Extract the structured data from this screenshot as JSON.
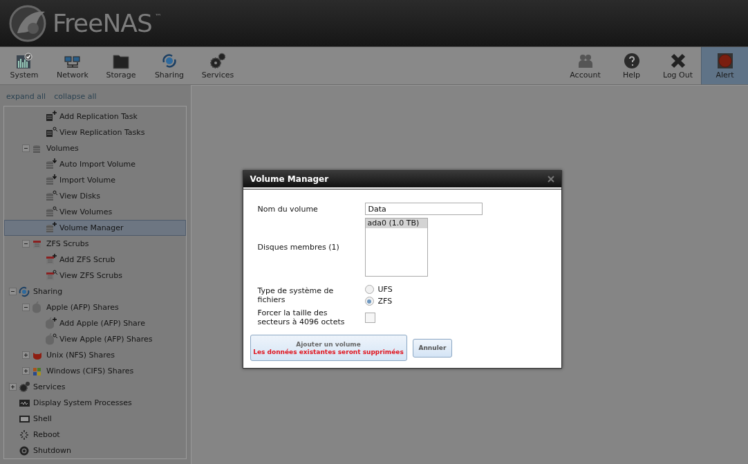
{
  "header": {
    "logo_text": "FreeNAS",
    "trademark": "™"
  },
  "toolbar": {
    "left": [
      {
        "label": "System",
        "kind": "system",
        "selected": false
      },
      {
        "label": "Network",
        "kind": "network",
        "selected": false
      },
      {
        "label": "Storage",
        "kind": "storage",
        "selected": false
      },
      {
        "label": "Sharing",
        "kind": "sharing",
        "selected": false
      },
      {
        "label": "Services",
        "kind": "services",
        "selected": false
      }
    ],
    "right": [
      {
        "label": "Account",
        "kind": "account",
        "selected": false
      },
      {
        "label": "Help",
        "kind": "help",
        "selected": false
      },
      {
        "label": "Log Out",
        "kind": "logout",
        "selected": false
      },
      {
        "label": "Alert",
        "kind": "alert",
        "selected": true
      }
    ]
  },
  "sidebar": {
    "links": [
      "expand all",
      "collapse all"
    ],
    "tree": [
      {
        "children": [
          {
            "children": [
              {
                "label": "Add Replication Task",
                "kind": "document_add",
                "selected": false
              },
              {
                "label": "View Replication Tasks",
                "kind": "document_view",
                "selected": false
              }
            ]
          },
          {
            "label": "Volumes",
            "kind": "disk",
            "expanded": true,
            "selected": false,
            "children": [
              {
                "label": "Auto Import Volume",
                "kind": "disk_import",
                "selected": false
              },
              {
                "label": "Import Volume",
                "kind": "disk_import",
                "selected": false
              },
              {
                "label": "View Disks",
                "kind": "disk_view",
                "selected": false
              },
              {
                "label": "View Volumes",
                "kind": "disk_view",
                "selected": false
              },
              {
                "label": "Volume Manager",
                "kind": "disk_add",
                "selected": true
              }
            ]
          },
          {
            "label": "ZFS Scrubs",
            "kind": "calendar",
            "expanded": true,
            "selected": false,
            "children": [
              {
                "label": "Add ZFS Scrub",
                "kind": "calendar_add",
                "selected": false
              },
              {
                "label": "View ZFS Scrubs",
                "kind": "calendar_view",
                "selected": false
              }
            ]
          }
        ]
      },
      {
        "label": "Sharing",
        "kind": "sharing",
        "expanded": true,
        "selected": false,
        "children": [
          {
            "label": "Apple (AFP) Shares",
            "kind": "apple",
            "expanded": true,
            "selected": false,
            "children": [
              {
                "label": "Add Apple (AFP) Share",
                "kind": "apple_add",
                "selected": false
              },
              {
                "label": "View Apple (AFP) Shares",
                "kind": "apple_view",
                "selected": false
              }
            ]
          },
          {
            "label": "Unix (NFS) Shares",
            "kind": "unix",
            "expanded": false,
            "selected": false
          },
          {
            "label": "Windows (CIFS) Shares",
            "kind": "windows",
            "expanded": false,
            "selected": false
          }
        ]
      },
      {
        "label": "Services",
        "kind": "gear",
        "expanded": false,
        "selected": false
      },
      {
        "label": "Display System Processes",
        "kind": "monitor",
        "selected": false
      },
      {
        "label": "Shell",
        "kind": "terminal",
        "selected": false
      },
      {
        "label": "Reboot",
        "kind": "spinner",
        "selected": false
      },
      {
        "label": "Shutdown",
        "kind": "power",
        "selected": false
      }
    ]
  },
  "dialog": {
    "title": "Volume Manager",
    "name_label": "Nom du volume",
    "name_value": "Data",
    "disks_label": "Disques membres (1)",
    "disks": [
      {
        "label": "ada0 (1.0 TB)",
        "selected": true
      }
    ],
    "fs_label": "Type de système de fichiers",
    "fs_options": [
      {
        "label": "UFS",
        "selected": false
      },
      {
        "label": "ZFS",
        "selected": true
      }
    ],
    "force_label": "Forcer la taille des secteurs à 4096 octets",
    "force_checked": false,
    "submit": {
      "label": "Ajouter un volume",
      "warning": "Les données existantes seront supprimées"
    },
    "cancel": "Annuler"
  }
}
